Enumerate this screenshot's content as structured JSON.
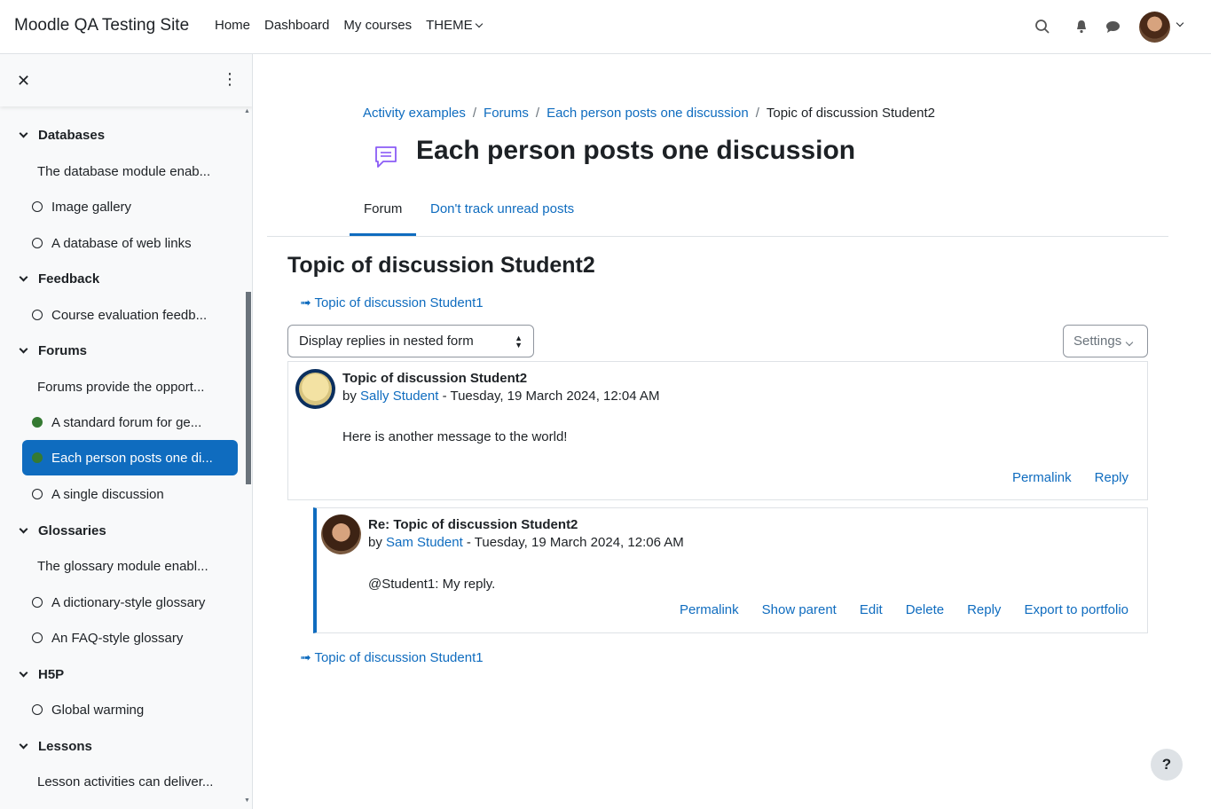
{
  "site": {
    "title": "Moodle QA Testing Site"
  },
  "nav": {
    "items": [
      "Home",
      "Dashboard",
      "My courses"
    ],
    "theme_label": "THEME"
  },
  "icons": {
    "search": "search-icon",
    "bell": "bell-icon",
    "chat": "chat-icon",
    "close": "close-icon",
    "kebab": "kebab-icon",
    "forum": "forum-icon"
  },
  "drawer": {
    "close_symbol": "✕",
    "kebab_symbol": "⋮",
    "rows": [
      {
        "type": "section",
        "label": "Databases"
      },
      {
        "type": "desc",
        "label": "The database module enab..."
      },
      {
        "type": "activity",
        "label": "Image gallery",
        "done": false
      },
      {
        "type": "activity",
        "label": "A database of web links",
        "done": false
      },
      {
        "type": "section",
        "label": "Feedback"
      },
      {
        "type": "activity",
        "label": "Course evaluation feedb...",
        "done": false
      },
      {
        "type": "section",
        "label": "Forums"
      },
      {
        "type": "desc",
        "label": "Forums provide the opport..."
      },
      {
        "type": "activity",
        "label": "A standard forum for ge...",
        "done": true
      },
      {
        "type": "activity",
        "label": "Each person posts one di...",
        "done": true,
        "active": true
      },
      {
        "type": "activity",
        "label": "A single discussion",
        "done": false
      },
      {
        "type": "section",
        "label": "Glossaries"
      },
      {
        "type": "desc",
        "label": "The glossary module enabl..."
      },
      {
        "type": "activity",
        "label": "A dictionary-style glossary",
        "done": false
      },
      {
        "type": "activity",
        "label": "An FAQ-style glossary",
        "done": false
      },
      {
        "type": "section",
        "label": "H5P"
      },
      {
        "type": "activity",
        "label": "Global warming",
        "done": false
      },
      {
        "type": "section",
        "label": "Lessons"
      },
      {
        "type": "desc",
        "label": "Lesson activities can deliver..."
      }
    ]
  },
  "breadcrumb": {
    "items": [
      "Activity examples",
      "Forums",
      "Each person posts one discussion"
    ],
    "current": "Topic of discussion Student2"
  },
  "page": {
    "title": "Each person posts one discussion"
  },
  "tabs": {
    "forum": "Forum",
    "track": "Don't track unread posts"
  },
  "discussion": {
    "title": "Topic of discussion Student2",
    "prev_link": "➟ Topic of discussion Student1",
    "next_link": "➟ Topic of discussion Student1",
    "display_mode": "Display replies in nested form",
    "settings_label": "Settings"
  },
  "posts": [
    {
      "subject": "Topic of discussion Student2",
      "by": "by ",
      "author": "Sally Student",
      "date": " - Tuesday, 19 March 2024, 12:04 AM",
      "body": "Here is another message to the world!",
      "actions": [
        "Permalink",
        "Reply"
      ]
    },
    {
      "subject": "Re: Topic of discussion Student2",
      "by": "by ",
      "author": "Sam Student",
      "date": " - Tuesday, 19 March 2024, 12:06 AM",
      "body": "@Student1: My reply.",
      "actions": [
        "Permalink",
        "Show parent",
        "Edit",
        "Delete",
        "Reply",
        "Export to portfolio"
      ]
    }
  ],
  "help": {
    "label": "?"
  },
  "colors": {
    "link": "#0f6cbf",
    "active": "#0f6cbf",
    "complete": "#357a32",
    "text": "#1d2125"
  }
}
